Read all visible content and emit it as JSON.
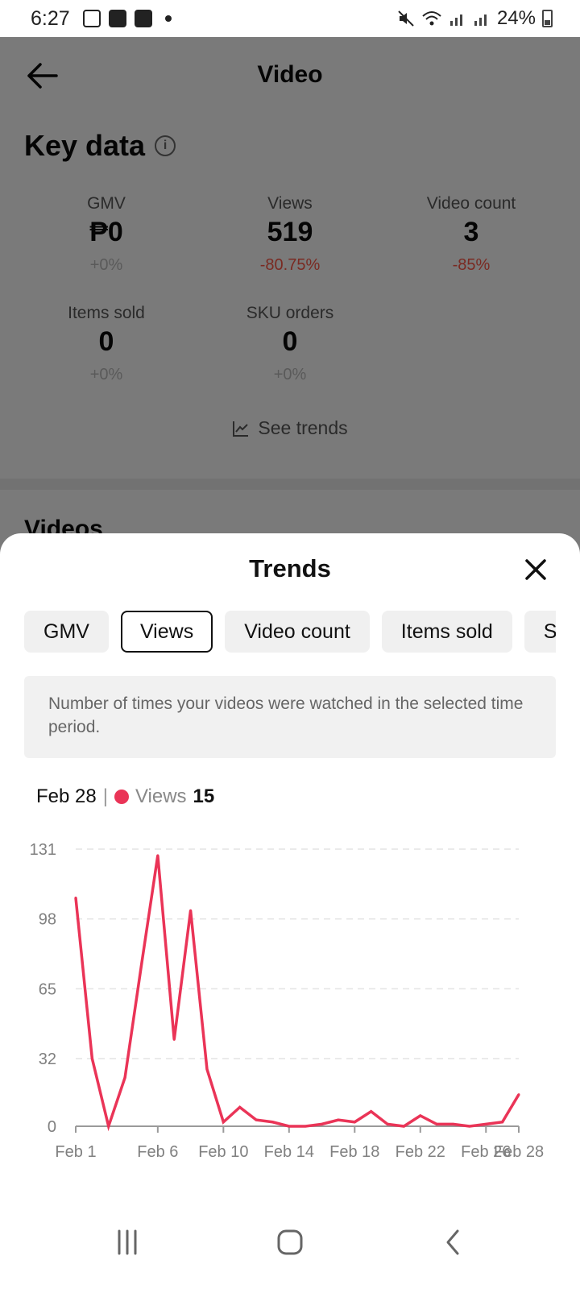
{
  "status_bar": {
    "time": "6:27",
    "battery": "24%"
  },
  "header": {
    "title": "Video"
  },
  "key_data": {
    "title": "Key data",
    "metrics": [
      {
        "label": "GMV",
        "value": "₱0",
        "change": "+0%"
      },
      {
        "label": "Views",
        "value": "519",
        "change": "-80.75%"
      },
      {
        "label": "Video count",
        "value": "3",
        "change": "-85%"
      },
      {
        "label": "Items sold",
        "value": "0",
        "change": "+0%"
      },
      {
        "label": "SKU orders",
        "value": "0",
        "change": "+0%"
      }
    ],
    "see_trends": "See trends"
  },
  "videos": {
    "title": "Videos"
  },
  "sheet": {
    "title": "Trends",
    "tabs": [
      {
        "label": "GMV"
      },
      {
        "label": "Views",
        "active": true
      },
      {
        "label": "Video count"
      },
      {
        "label": "Items sold"
      },
      {
        "label": "SKU orders"
      }
    ],
    "description": "Number of times your videos were watched in the selected time period.",
    "tooltip": {
      "date": "Feb 28",
      "separator": "|",
      "series": "Views",
      "value": "15"
    }
  },
  "colors": {
    "accent": "#ea3457",
    "negative": "#7a2a22"
  },
  "chart_data": {
    "type": "line",
    "x": [
      "Feb 1",
      "Feb 2",
      "Feb 3",
      "Feb 4",
      "Feb 5",
      "Feb 6",
      "Feb 7",
      "Feb 8",
      "Feb 9",
      "Feb 10",
      "Feb 11",
      "Feb 12",
      "Feb 13",
      "Feb 14",
      "Feb 15",
      "Feb 16",
      "Feb 17",
      "Feb 18",
      "Feb 19",
      "Feb 20",
      "Feb 21",
      "Feb 22",
      "Feb 23",
      "Feb 24",
      "Feb 25",
      "Feb 26",
      "Feb 27",
      "Feb 28"
    ],
    "series": [
      {
        "name": "Views",
        "values": [
          108,
          32,
          0,
          23,
          76,
          128,
          41,
          102,
          27,
          2,
          9,
          3,
          2,
          0,
          0,
          1,
          3,
          2,
          7,
          1,
          0,
          5,
          1,
          1,
          0,
          1,
          2,
          15
        ]
      }
    ],
    "x_tick_labels": [
      "Feb 1",
      "Feb 6",
      "Feb 10",
      "Feb 14",
      "Feb 18",
      "Feb 22",
      "Feb 26",
      "Feb 28"
    ],
    "x_tick_indices": [
      0,
      5,
      9,
      13,
      17,
      21,
      25,
      27
    ],
    "y_ticks": [
      "0",
      "32",
      "65",
      "98",
      "131"
    ],
    "ylim": [
      0,
      131
    ],
    "grid": "horizontal dashed"
  }
}
